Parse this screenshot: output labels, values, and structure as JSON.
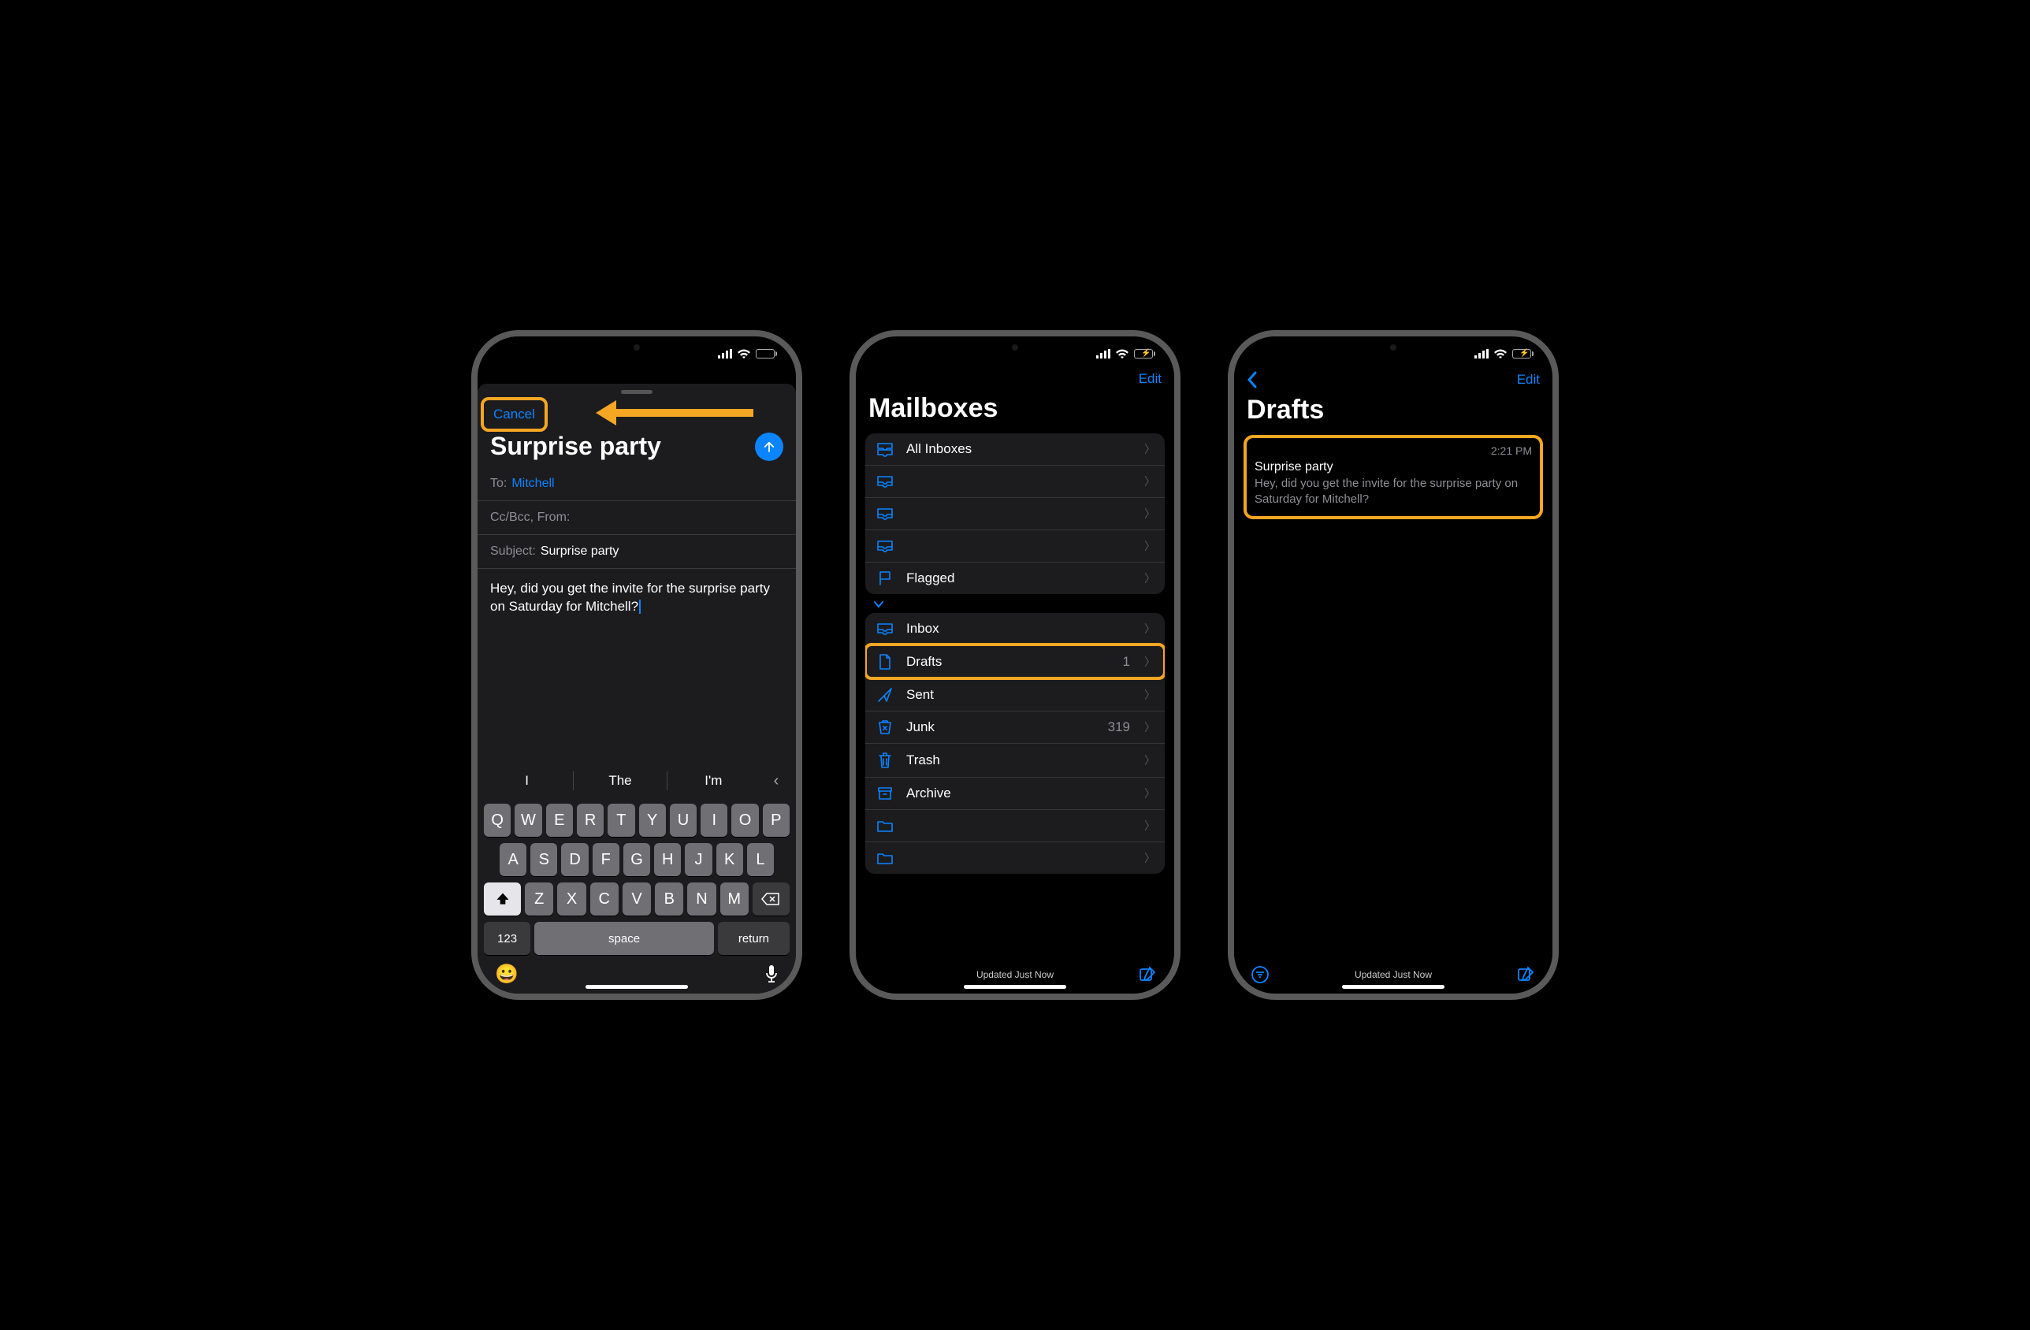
{
  "phone1": {
    "cancel": "Cancel",
    "title": "Surprise party",
    "to_label": "To:",
    "to_value": "Mitchell",
    "cc_label": "Cc/Bcc, From:",
    "subject_label": "Subject:",
    "subject_value": "Surprise party",
    "body": "Hey, did you get the invite for the surprise party on Saturday for Mitchell?",
    "suggestions": [
      "I",
      "The",
      "I'm"
    ],
    "keys_r1": [
      "Q",
      "W",
      "E",
      "R",
      "T",
      "Y",
      "U",
      "I",
      "O",
      "P"
    ],
    "keys_r2": [
      "A",
      "S",
      "D",
      "F",
      "G",
      "H",
      "J",
      "K",
      "L"
    ],
    "keys_r3": [
      "Z",
      "X",
      "C",
      "V",
      "B",
      "N",
      "M"
    ],
    "key_123": "123",
    "key_space": "space",
    "key_return": "return"
  },
  "phone2": {
    "edit": "Edit",
    "title": "Mailboxes",
    "group1": [
      {
        "label": "All Inboxes",
        "icon": "inboxes"
      },
      {
        "label": "",
        "icon": "inbox"
      },
      {
        "label": "",
        "icon": "inbox"
      },
      {
        "label": "",
        "icon": "inbox"
      },
      {
        "label": "Flagged",
        "icon": "flag"
      }
    ],
    "group2": [
      {
        "label": "Inbox",
        "icon": "inbox",
        "count": ""
      },
      {
        "label": "Drafts",
        "icon": "doc",
        "count": "1",
        "hl": true
      },
      {
        "label": "Sent",
        "icon": "send",
        "count": ""
      },
      {
        "label": "Junk",
        "icon": "junk",
        "count": "319"
      },
      {
        "label": "Trash",
        "icon": "trash",
        "count": ""
      },
      {
        "label": "Archive",
        "icon": "archive",
        "count": ""
      },
      {
        "label": "",
        "icon": "folder",
        "count": ""
      },
      {
        "label": "",
        "icon": "folder",
        "count": ""
      }
    ],
    "status": "Updated Just Now"
  },
  "phone3": {
    "edit": "Edit",
    "title": "Drafts",
    "item": {
      "time": "2:21 PM",
      "subject": "Surprise party",
      "preview": "Hey, did you get the invite for the surprise party on Saturday for Mitchell?"
    },
    "status": "Updated Just Now"
  }
}
